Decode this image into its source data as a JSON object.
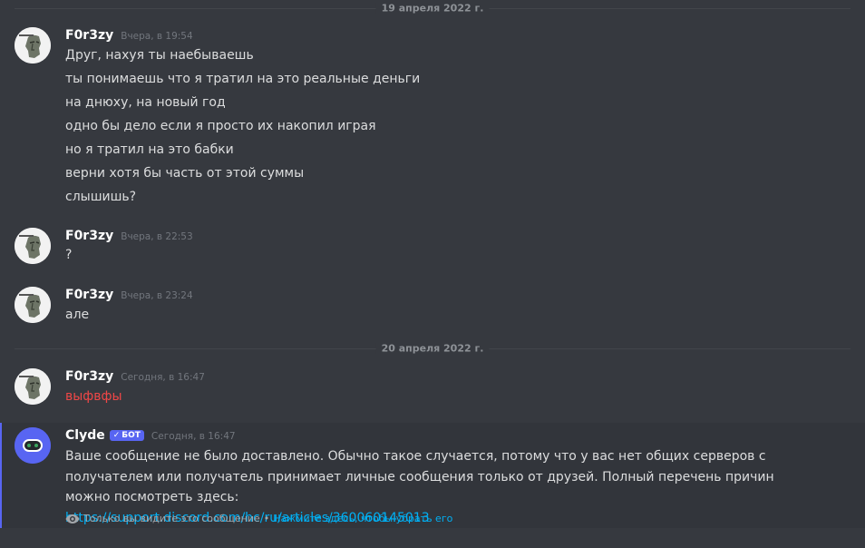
{
  "dividers": [
    {
      "label": "19 апреля 2022 г."
    },
    {
      "label": "20 апреля 2022 г."
    }
  ],
  "messages": [
    {
      "username": "F0r3zy",
      "timestamp": "Вчера, в 19:54",
      "lines": [
        "Друг, нахуя ты наебываешь",
        "ты понимаешь что я тратил на это реальные деньги",
        "на днюху, на новый год",
        "одно бы дело если я просто их накопил играя",
        "но я тратил на это бабки",
        "верни хотя бы часть от этой суммы",
        "слышишь?"
      ]
    },
    {
      "username": "F0r3zy",
      "timestamp": "Вчера, в 22:53",
      "lines": [
        "?"
      ]
    },
    {
      "username": "F0r3zy",
      "timestamp": "Вчера, в 23:24",
      "lines": [
        "але"
      ]
    },
    {
      "username": "F0r3zy",
      "timestamp": "Сегодня, в 16:47",
      "lines": [
        "выфвфы"
      ]
    }
  ],
  "clyde": {
    "username": "Clyde",
    "badge": "БОТ",
    "timestamp": "Сегодня, в 16:47",
    "text": "Ваше сообщение не было доставлено. Обычно такое случается, потому что у вас нет общих серверов с получателем или получатель принимает личные сообщения только от друзей. Полный перечень причин можно посмотреть здесь:",
    "link": "https://support.discord.com/hc/ru/articles/360060145013",
    "ephemeral_note": "Только вы видите это сообщение",
    "separator": "•",
    "dismiss": "Нажмите здесь, чтобы убрать его"
  },
  "colors": {
    "background": "#36393f",
    "accent": "#5865f2",
    "link": "#00b0f4",
    "error_text": "#f04747"
  }
}
